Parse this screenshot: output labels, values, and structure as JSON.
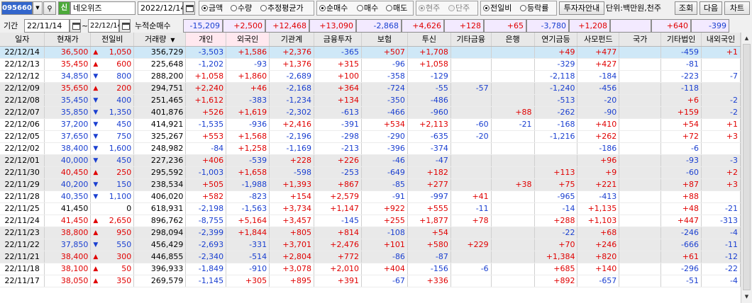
{
  "toolbar": {
    "code": "095660",
    "badge": "신",
    "name": "네오위즈",
    "date": "2022/12/14",
    "unit_opts": [
      "금액",
      "수량",
      "추정평균가"
    ],
    "unit_sel": 0,
    "trade_opts": [
      "순매수",
      "매수",
      "매도"
    ],
    "trade_sel": 0,
    "contract_opts": [
      "현주",
      "단주"
    ],
    "contract_sel": 0,
    "compare_opts": [
      "전일비",
      "등락률"
    ],
    "compare_sel": 0,
    "investor_btn": "투자자안내",
    "unit_label": "단위:백만원,천주",
    "query_btn": "조회",
    "next_btn": "다음",
    "chart_btn": "차트"
  },
  "period": {
    "label": "기간",
    "start": "22/11/14",
    "sep": "~",
    "end": "22/12/14",
    "cum_label": "누적순매수",
    "totals": [
      "-15,209",
      "+2,500",
      "+12,468",
      "+13,090",
      "-2,868",
      "+4,626",
      "+128",
      "+65",
      "-3,780",
      "+1,208",
      "",
      "+640",
      "-399"
    ]
  },
  "columns": [
    "일자",
    "현재가",
    "전일비",
    "거래량",
    "개인",
    "외국인",
    "기관계",
    "금융투자",
    "보험",
    "투신",
    "기타금융",
    "은행",
    "연기금등",
    "사모펀드",
    "국가",
    "기타법인",
    "내외국인"
  ],
  "rows": [
    [
      "22/12/14",
      "36,500",
      "up",
      "1,050",
      "356,729",
      "-3,503",
      "+1,586",
      "+2,376",
      "-365",
      "+507",
      "+1,708",
      "",
      "",
      "+49",
      "+477",
      "",
      "-459",
      "+1"
    ],
    [
      "22/12/13",
      "35,450",
      "up",
      "600",
      "225,648",
      "-1,202",
      "-93",
      "+1,376",
      "+315",
      "-96",
      "+1,058",
      "",
      "",
      "-329",
      "+427",
      "",
      "-81",
      ""
    ],
    [
      "22/12/12",
      "34,850",
      "dn",
      "800",
      "288,200",
      "+1,058",
      "+1,860",
      "-2,689",
      "+100",
      "-358",
      "-129",
      "",
      "",
      "-2,118",
      "-184",
      "",
      "-223",
      "-7"
    ],
    [
      "22/12/09",
      "35,650",
      "up",
      "200",
      "294,751",
      "+2,240",
      "+46",
      "-2,168",
      "+364",
      "-724",
      "-55",
      "-57",
      "",
      "-1,240",
      "-456",
      "",
      "-118",
      ""
    ],
    [
      "22/12/08",
      "35,450",
      "dn",
      "400",
      "251,465",
      "+1,612",
      "-383",
      "-1,234",
      "+134",
      "-350",
      "-486",
      "",
      "",
      "-513",
      "-20",
      "",
      "+6",
      "-2"
    ],
    [
      "22/12/07",
      "35,850",
      "dn",
      "1,350",
      "401,876",
      "+526",
      "+1,619",
      "-2,302",
      "-613",
      "-466",
      "-960",
      "",
      "+88",
      "-262",
      "-90",
      "",
      "+159",
      "-2"
    ],
    [
      "22/12/06",
      "37,200",
      "dn",
      "450",
      "414,921",
      "-1,535",
      "-936",
      "+2,416",
      "-391",
      "+534",
      "+2,113",
      "-60",
      "-21",
      "-168",
      "+410",
      "",
      "+54",
      "+1"
    ],
    [
      "22/12/05",
      "37,650",
      "dn",
      "750",
      "325,267",
      "+553",
      "+1,568",
      "-2,196",
      "-298",
      "-290",
      "-635",
      "-20",
      "",
      "-1,216",
      "+262",
      "",
      "+72",
      "+3"
    ],
    [
      "22/12/02",
      "38,400",
      "dn",
      "1,600",
      "248,982",
      "-84",
      "+1,258",
      "-1,169",
      "-213",
      "-396",
      "-374",
      "",
      "",
      "",
      "-186",
      "",
      "-6",
      ""
    ],
    [
      "22/12/01",
      "40,000",
      "dn",
      "450",
      "227,236",
      "+406",
      "-539",
      "+228",
      "+226",
      "-46",
      "-47",
      "",
      "",
      "",
      "+96",
      "",
      "-93",
      "-3"
    ],
    [
      "22/11/30",
      "40,450",
      "up",
      "250",
      "295,592",
      "-1,003",
      "+1,658",
      "-598",
      "-253",
      "-649",
      "+182",
      "",
      "",
      "+113",
      "+9",
      "",
      "-60",
      "+2"
    ],
    [
      "22/11/29",
      "40,200",
      "dn",
      "150",
      "238,534",
      "+505",
      "-1,988",
      "+1,393",
      "+867",
      "-85",
      "+277",
      "",
      "+38",
      "+75",
      "+221",
      "",
      "+87",
      "+3"
    ],
    [
      "22/11/28",
      "40,350",
      "dn",
      "1,100",
      "406,020",
      "+582",
      "-823",
      "+154",
      "+2,579",
      "-91",
      "-997",
      "+41",
      "",
      "-965",
      "-413",
      "",
      "+88",
      ""
    ],
    [
      "22/11/25",
      "41,450",
      "",
      "0",
      "618,931",
      "-2,198",
      "-1,563",
      "+3,734",
      "+1,147",
      "+922",
      "+555",
      "-11",
      "",
      "-14",
      "+1,135",
      "",
      "+48",
      "-21"
    ],
    [
      "22/11/24",
      "41,450",
      "up",
      "2,650",
      "896,762",
      "-8,755",
      "+5,164",
      "+3,457",
      "-145",
      "+255",
      "+1,877",
      "+78",
      "",
      "+288",
      "+1,103",
      "",
      "+447",
      "-313"
    ],
    [
      "22/11/23",
      "38,800",
      "up",
      "950",
      "298,094",
      "-2,399",
      "+1,844",
      "+805",
      "+814",
      "-108",
      "+54",
      "",
      "",
      "-22",
      "+68",
      "",
      "-246",
      "-4"
    ],
    [
      "22/11/22",
      "37,850",
      "dn",
      "550",
      "456,429",
      "-2,693",
      "-331",
      "+3,701",
      "+2,476",
      "+101",
      "+580",
      "+229",
      "",
      "+70",
      "+246",
      "",
      "-666",
      "-11"
    ],
    [
      "22/11/21",
      "38,400",
      "up",
      "300",
      "446,855",
      "-2,340",
      "-514",
      "+2,804",
      "+772",
      "-86",
      "-87",
      "",
      "",
      "+1,384",
      "+820",
      "",
      "+61",
      "-12"
    ],
    [
      "22/11/18",
      "38,100",
      "up",
      "50",
      "396,933",
      "-1,849",
      "-910",
      "+3,078",
      "+2,010",
      "+404",
      "-156",
      "-6",
      "",
      "+685",
      "+140",
      "",
      "-296",
      "-22"
    ],
    [
      "22/11/17",
      "38,050",
      "up",
      "350",
      "269,579",
      "-1,145",
      "+305",
      "+895",
      "+391",
      "-67",
      "+336",
      "",
      "",
      "+892",
      "-657",
      "",
      "-51",
      "-4"
    ]
  ],
  "row_shading": [
    "sel",
    "",
    "",
    "shade",
    "shade",
    "shade",
    "",
    "",
    "",
    "shade",
    "shade",
    "shade",
    "",
    "",
    "",
    "shade",
    "shade",
    "shade",
    "",
    ""
  ],
  "colors": {
    "up": "#e00000",
    "down": "#1a3fd0",
    "selected_row": "#cfe8f7",
    "header_highlight": "#ffe8ef"
  },
  "icons": [
    "calendar-icon",
    "dropdown-arrow-icon",
    "search-icon",
    "scroll-up-icon",
    "scroll-down-icon",
    "sort-arrow-icon"
  ]
}
